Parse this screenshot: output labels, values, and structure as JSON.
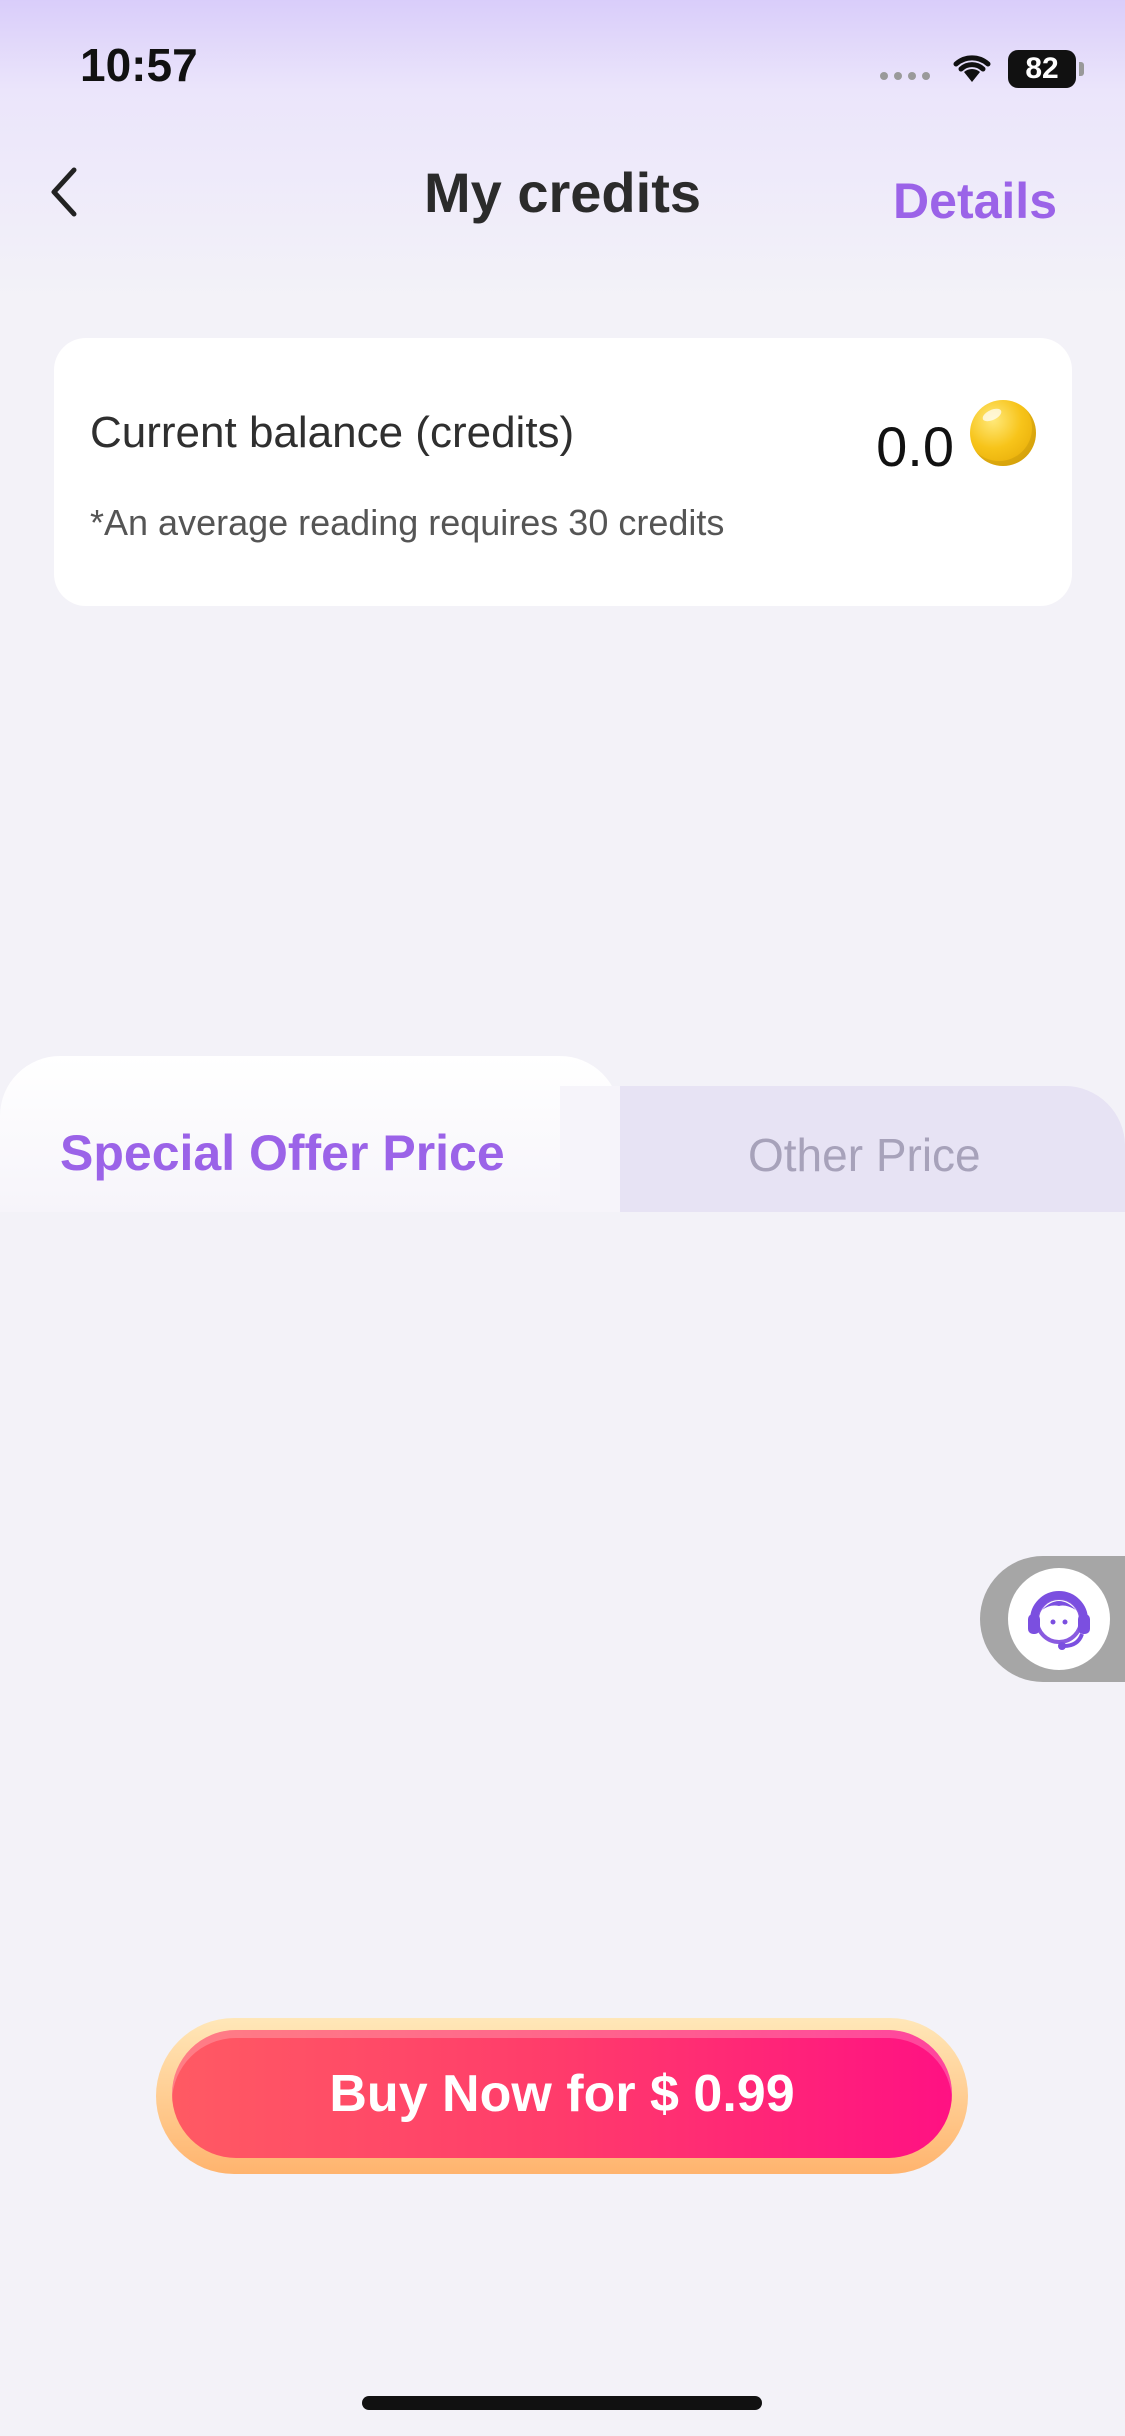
{
  "status_bar": {
    "time": "10:57",
    "battery": "82"
  },
  "header": {
    "title": "My credits",
    "details_label": "Details"
  },
  "balance": {
    "label": "Current balance (credits)",
    "value": "0.0",
    "note": "*An average reading requires 30 credits"
  },
  "tabs": [
    {
      "label": "Special Offer Price",
      "active": true
    },
    {
      "label": "Other Price",
      "active": false
    }
  ],
  "actions": {
    "buy_label": "Buy Now for $ 0.99"
  },
  "icons": {
    "back": "chevron-left-icon",
    "coin": "coin-icon",
    "support": "customer-support-icon",
    "wifi": "wifi-icon",
    "battery": "battery-icon"
  },
  "colors": {
    "accent": "#9b63e8",
    "buy_gradient_start": "#ff5a63",
    "buy_gradient_end": "#ff1183",
    "background": "#f3f2f8"
  }
}
